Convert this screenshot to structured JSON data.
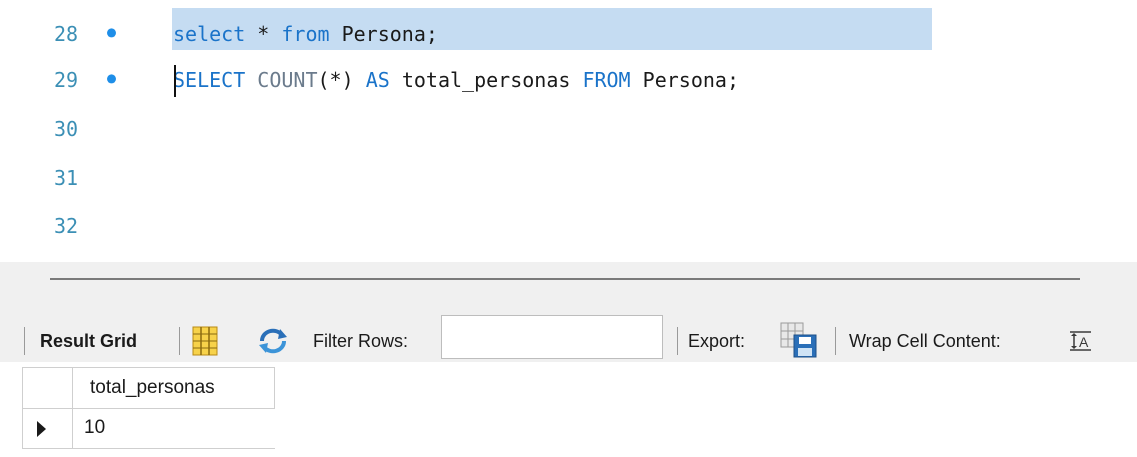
{
  "editor": {
    "lines": [
      {
        "number": "28",
        "has_marker": true
      },
      {
        "number": "29",
        "has_marker": true
      },
      {
        "number": "30",
        "has_marker": false
      },
      {
        "number": "31",
        "has_marker": false
      },
      {
        "number": "32",
        "has_marker": false
      }
    ],
    "line28": {
      "kw1": "select",
      "star": " * ",
      "kw2": "from",
      "rest": " Persona;"
    },
    "line29": {
      "kw1": "SELECT",
      "sp1": " ",
      "fn": "COUNT",
      "paren": "(*) ",
      "kw2": "AS",
      "alias": " total_personas ",
      "kw3": "FROM",
      "rest": " Persona;"
    },
    "marker_icon": "execution-dot-icon"
  },
  "toolbar": {
    "result_grid_label": "Result Grid",
    "filter_rows_label": "Filter Rows:",
    "filter_rows_value": "",
    "export_label": "Export:",
    "wrap_cell_label": "Wrap Cell Content:",
    "icons": [
      "grid-layout-icon",
      "refresh-icon",
      "export-save-icon",
      "wrap-text-icon"
    ]
  },
  "result_grid": {
    "columns": [
      "total_personas"
    ],
    "rows": [
      [
        "10"
      ]
    ],
    "row_indicator_icon": "current-row-arrow-icon"
  },
  "colors": {
    "keyword": "#1a73c9",
    "function": "#6b7b8c",
    "line_number": "#3b8fb5",
    "selection": "#c5dcf2",
    "marker": "#1e8ee8"
  }
}
